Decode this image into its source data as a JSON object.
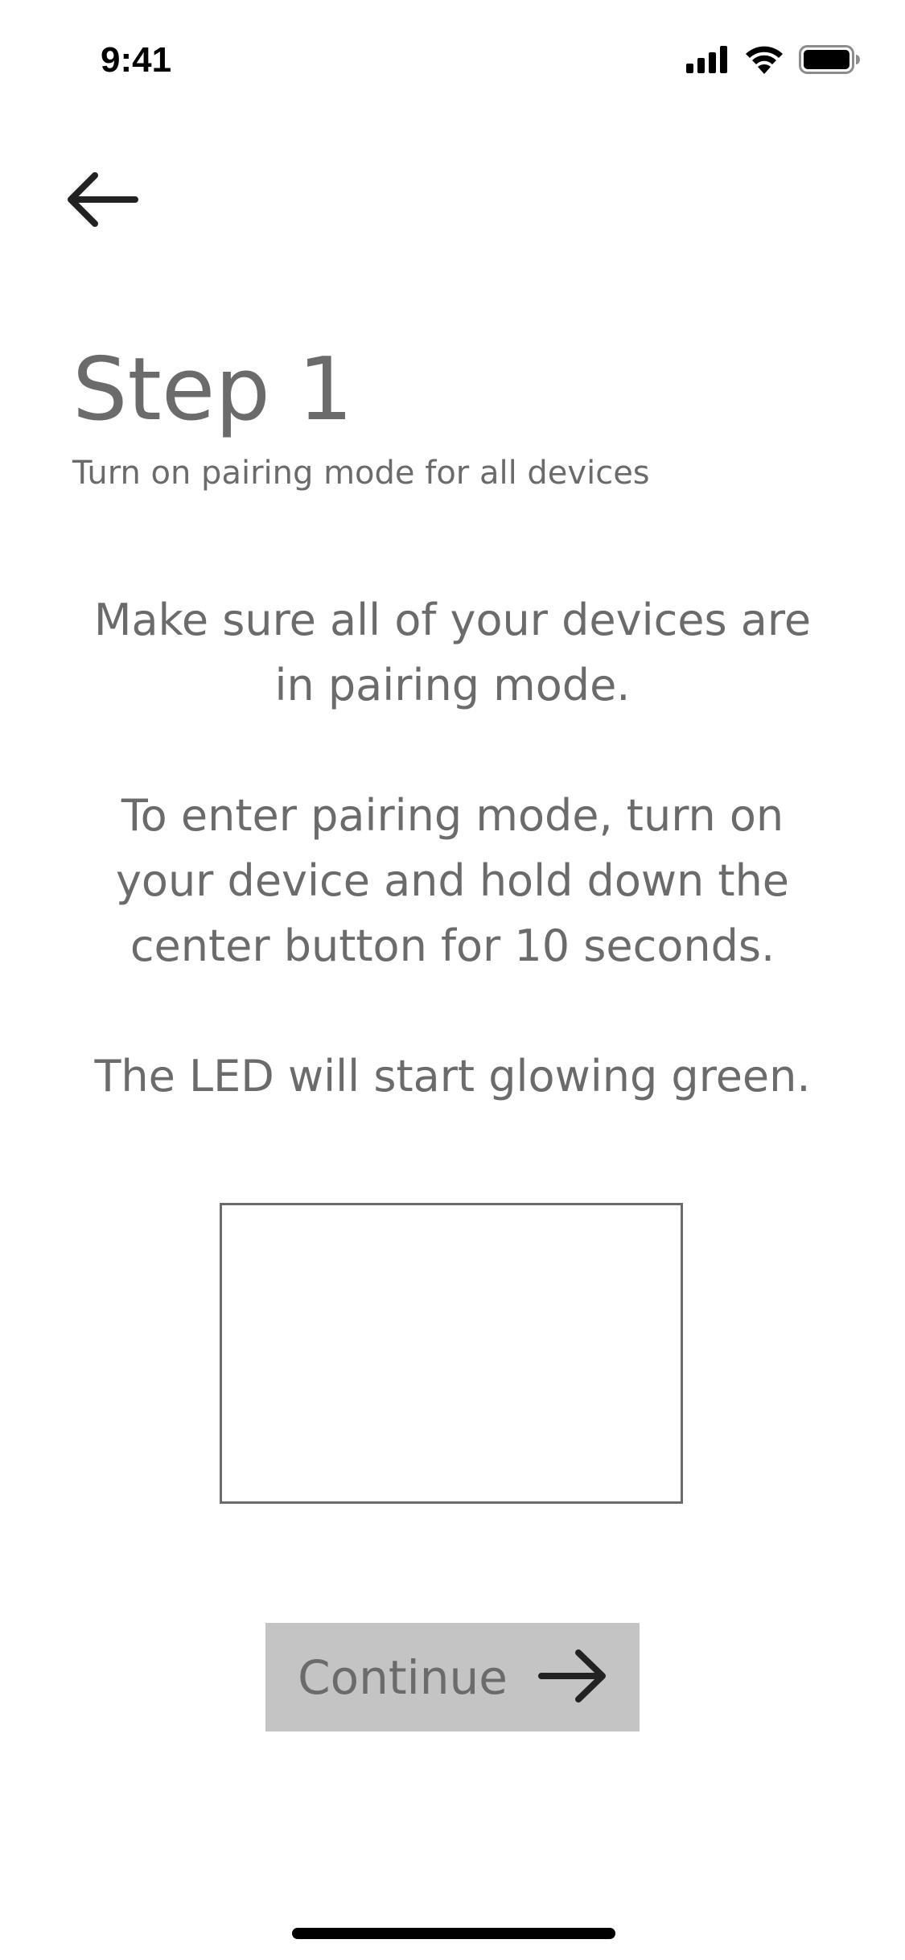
{
  "status_bar": {
    "time": "9:41",
    "icons": [
      "cellular-signal-icon",
      "wifi-icon",
      "battery-icon"
    ]
  },
  "navigation": {
    "back_icon": "arrow-left-icon"
  },
  "header": {
    "title": "Step 1",
    "subtitle": "Turn on pairing mode for all devices"
  },
  "instructions": {
    "paragraphs": [
      "Make sure all of your devices are in pairing mode.",
      "To enter pairing mode, turn on your device and hold down the center button for 10 seconds.",
      "The LED will start glowing green."
    ]
  },
  "continue_button": {
    "label": "Continue",
    "icon": "arrow-right-icon",
    "background_color": "#c4c4c4"
  },
  "colors": {
    "text": "#6b6b6b",
    "icon": "#222222",
    "background": "#ffffff"
  }
}
